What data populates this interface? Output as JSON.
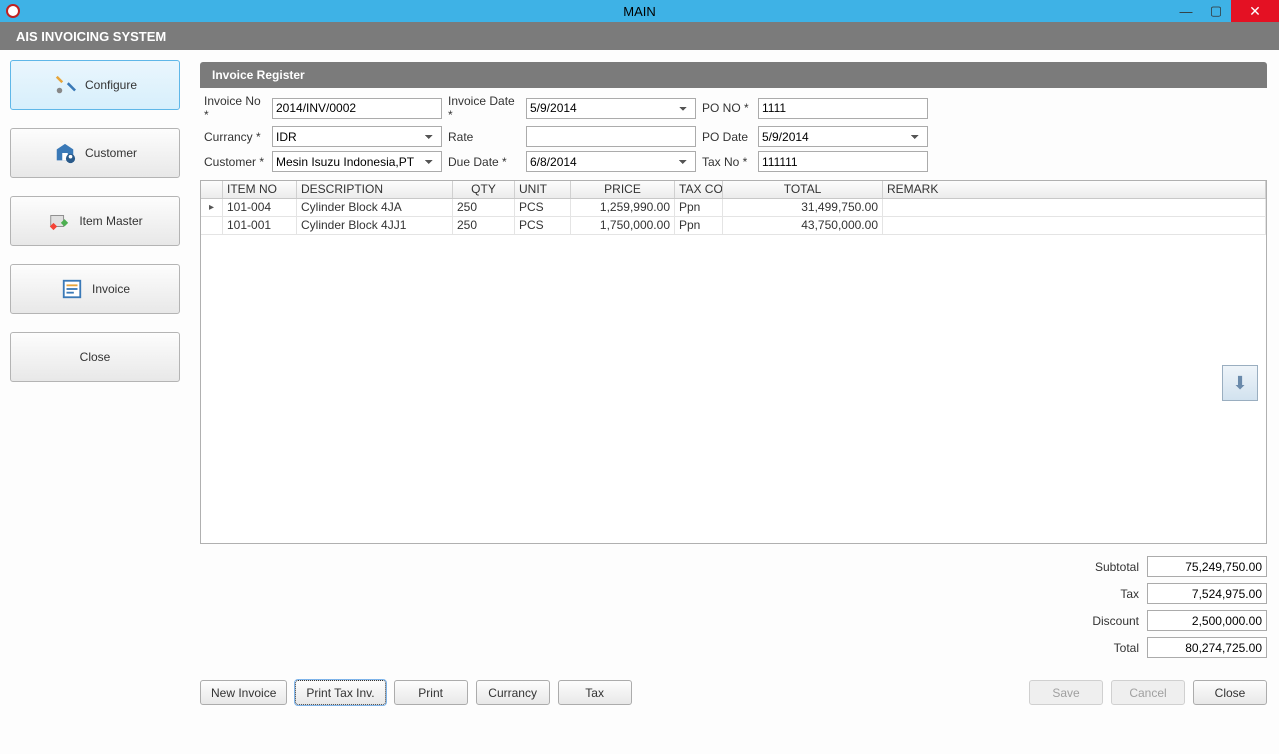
{
  "window": {
    "title": "MAIN"
  },
  "system_title": "AIS INVOICING SYSTEM",
  "sidebar": {
    "configure": "Configure",
    "customer": "Customer",
    "item_master": "Item Master",
    "invoice": "Invoice",
    "close": "Close"
  },
  "panel_title": "Invoice Register",
  "form": {
    "invoice_no_label": "Invoice No *",
    "invoice_no": "2014/INV/0002",
    "invoice_date_label": "Invoice Date *",
    "invoice_date": "5/9/2014",
    "po_no_label": "PO NO *",
    "po_no": "1111",
    "currency_label": "Currancy *",
    "currency": "IDR",
    "rate_label": "Rate",
    "rate": "",
    "po_date_label": "PO Date",
    "po_date": "5/9/2014",
    "customer_label": "Customer *",
    "customer": "Mesin Isuzu Indonesia,PT",
    "due_date_label": "Due Date *",
    "due_date": "6/8/2014",
    "tax_no_label": "Tax No *",
    "tax_no": "111111"
  },
  "grid": {
    "headers": {
      "item_no": "ITEM NO",
      "description": "DESCRIPTION",
      "qty": "QTY",
      "unit": "UNIT",
      "price": "PRICE",
      "tax_code": "TAX COD",
      "total": "TOTAL",
      "remark": "REMARK"
    },
    "rows": [
      {
        "item_no": "101-004",
        "description": "Cylinder Block 4JA",
        "qty": "250",
        "unit": "PCS",
        "price": "1,259,990.00",
        "tax_code": "Ppn",
        "total": "31,499,750.00",
        "remark": ""
      },
      {
        "item_no": "101-001",
        "description": "Cylinder Block 4JJ1",
        "qty": "250",
        "unit": "PCS",
        "price": "1,750,000.00",
        "tax_code": "Ppn",
        "total": "43,750,000.00",
        "remark": ""
      }
    ]
  },
  "totals": {
    "subtotal_label": "Subtotal",
    "subtotal": "75,249,750.00",
    "tax_label": "Tax",
    "tax": "7,524,975.00",
    "discount_label": "Discount",
    "discount": "2,500,000.00",
    "total_label": "Total",
    "total": "80,274,725.00"
  },
  "actions": {
    "new_invoice": "New Invoice",
    "print_tax_inv": "Print Tax Inv.",
    "print": "Print",
    "currency": "Currancy",
    "tax": "Tax",
    "save": "Save",
    "cancel": "Cancel",
    "close": "Close"
  }
}
